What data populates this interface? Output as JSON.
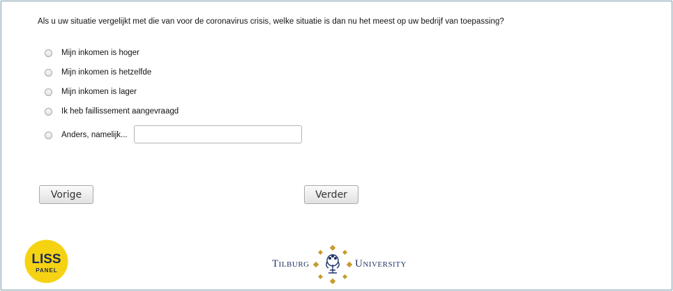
{
  "survey": {
    "question": "Als u uw situatie vergelijkt met die van voor de coronavirus crisis, welke situatie is dan nu het meest op uw bedrijf van toepassing?",
    "options": [
      {
        "label": "Mijn inkomen is hoger",
        "selected": false
      },
      {
        "label": "Mijn inkomen is hetzelfde",
        "selected": false
      },
      {
        "label": "Mijn inkomen is lager",
        "selected": false
      },
      {
        "label": "Ik heb faillissement aangevraagd",
        "selected": false
      },
      {
        "label": "Anders, namelijk...",
        "selected": false
      }
    ],
    "other_value": ""
  },
  "nav": {
    "prev_label": "Vorige",
    "next_label": "Verder"
  },
  "footer": {
    "liss_logo_text_top": "LISS",
    "liss_logo_text_bottom": "PANEL",
    "tilburg_left": "Tilburg",
    "tilburg_right": "University",
    "colors": {
      "liss_yellow": "#f5d312",
      "liss_text": "#1d2b57",
      "tilburg_navy": "#1f3566",
      "tilburg_gold": "#c79a2e"
    }
  }
}
